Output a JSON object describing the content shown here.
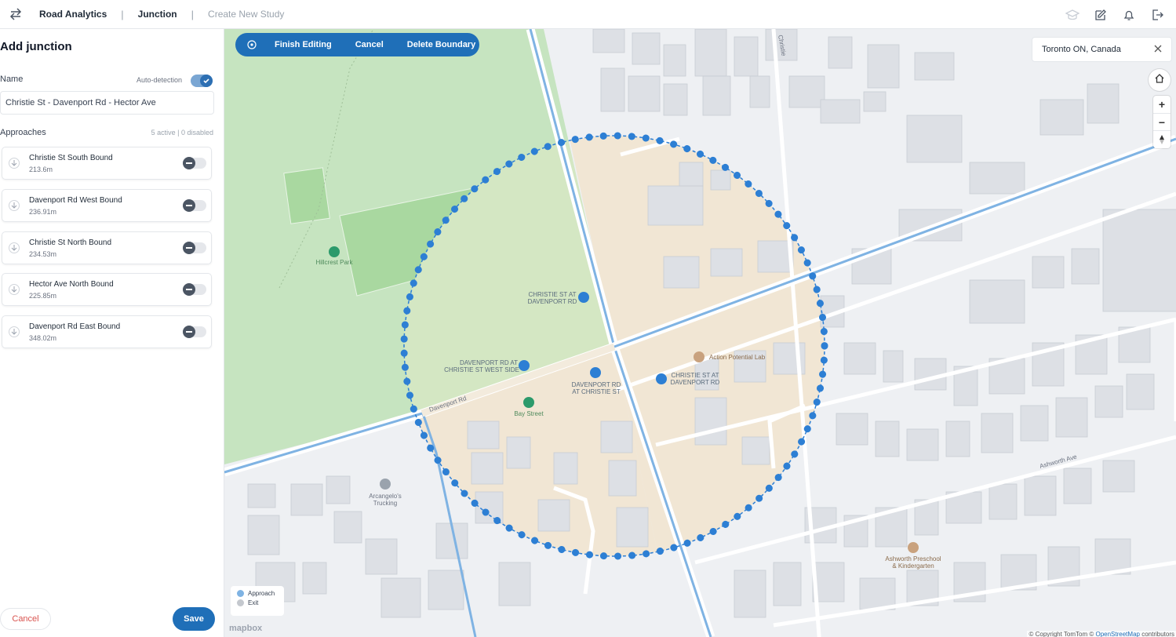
{
  "topbar": {
    "swap_icon": "swap-arrows-icon",
    "breadcrumbs": [
      "Road Analytics",
      "Junction",
      "Create New Study"
    ],
    "icons": [
      "graduation-cap-icon",
      "edit-icon",
      "bell-icon",
      "logout-icon"
    ]
  },
  "sidebar": {
    "title": "Add junction",
    "name_label": "Name",
    "auto_detection_label": "Auto-detection",
    "auto_detection_on": true,
    "name_value": "Christie St - Davenport Rd - Hector Ave",
    "approaches_label": "Approaches",
    "approach_count": "5 active | 0 disabled",
    "approaches": [
      {
        "name": "Christie St South Bound",
        "distance": "213.6m"
      },
      {
        "name": "Davenport Rd West Bound",
        "distance": "236.91m"
      },
      {
        "name": "Christie St North Bound",
        "distance": "234.53m"
      },
      {
        "name": "Hector Ave North Bound",
        "distance": "225.85m"
      },
      {
        "name": "Davenport Rd East Bound",
        "distance": "348.02m"
      }
    ],
    "cancel_label": "Cancel",
    "save_label": "Save"
  },
  "map": {
    "edit_bar": {
      "finish": "Finish Editing",
      "cancel": "Cancel",
      "delete": "Delete Boundary"
    },
    "search_value": "Toronto ON, Canada",
    "labels": {
      "park": "Hillcrest Park",
      "stop1": [
        "CHRISTIE ST AT",
        "DAVENPORT RD"
      ],
      "stop2": [
        "DAVENPORT RD AT",
        "CHRISTIE ST WEST SIDE"
      ],
      "stop3": [
        "DAVENPORT RD",
        "AT CHRISTIE ST"
      ],
      "stop4": [
        "CHRISTIE ST AT",
        "DAVENPORT RD"
      ],
      "lab": "Action Potential Lab",
      "bay": "Bay Street",
      "trucking": [
        "Arcangelo's",
        "Trucking"
      ],
      "preschool": [
        "Ashworth Preschool",
        "& Kindergarten"
      ],
      "davenport": "Davenport Rd",
      "ashworth": "Ashworth Ave",
      "christie_top": "Christie"
    },
    "legend": {
      "approach": "Approach",
      "exit": "Exit"
    },
    "colors": {
      "approach": "#7fb3e3",
      "exit": "#c4c8ce",
      "boundary": "#2d7fd4",
      "park": "#c6e4c0",
      "zone": "#f1e6d4"
    },
    "logo": "mapbox",
    "attribution_prefix": "© Copyright TomTom © ",
    "attribution_link": "OpenStreetMap",
    "attribution_suffix": " contributors"
  }
}
